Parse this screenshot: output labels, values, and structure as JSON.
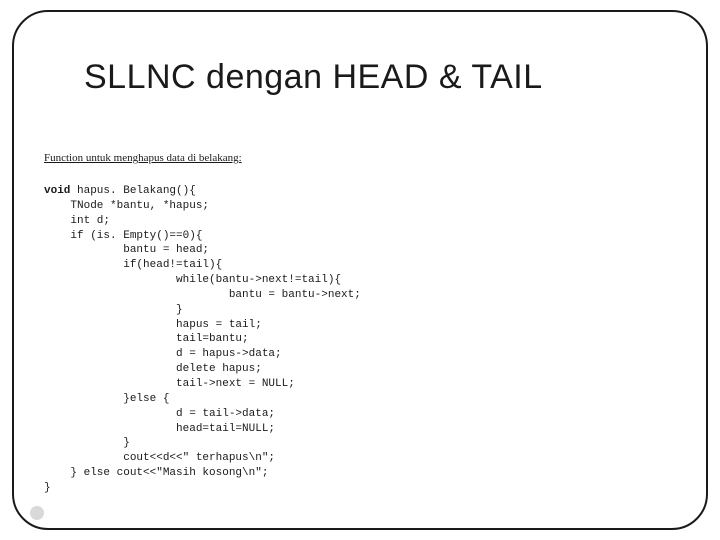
{
  "title": "SLLNC dengan HEAD & TAIL",
  "subtitle": "Function untuk menghapus data di belakang:",
  "code": {
    "kw_void": "void",
    "sig": " hapus. Belakang(){",
    "l02": "    TNode *bantu, *hapus;",
    "l03": "    int d;",
    "l04": "    if (is. Empty()==0){",
    "l05": "            bantu = head;",
    "l06": "            if(head!=tail){",
    "l07": "                    while(bantu->next!=tail){",
    "l08": "                            bantu = bantu->next;",
    "l09": "                    }",
    "l10": "                    hapus = tail;",
    "l11": "                    tail=bantu;",
    "l12": "                    d = hapus->data;",
    "l13": "                    delete hapus;",
    "l14": "                    tail->next = NULL;",
    "l15": "            }else {",
    "l16": "                    d = tail->data;",
    "l17": "                    head=tail=NULL;",
    "l18": "            }",
    "l19": "            cout<<d<<\" terhapus\\n\";",
    "l20": "    } else cout<<\"Masih kosong\\n\";",
    "l21": "}"
  }
}
